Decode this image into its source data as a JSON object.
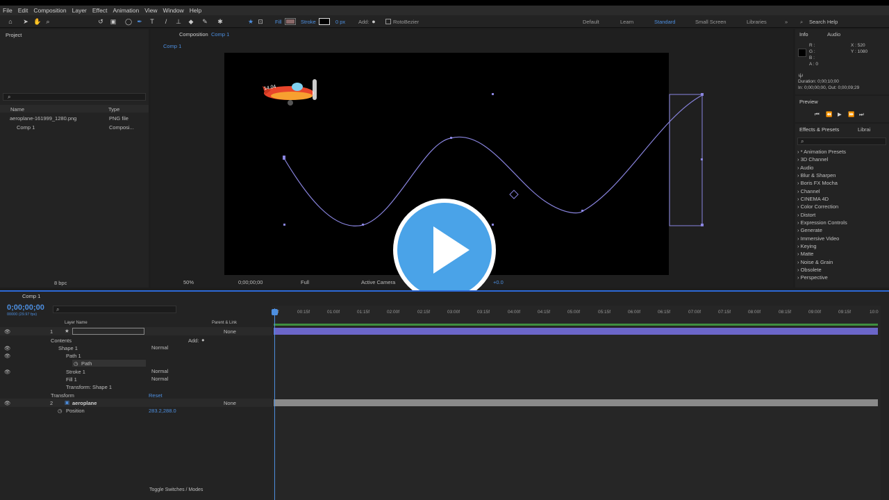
{
  "menu": [
    "File",
    "Edit",
    "Composition",
    "Layer",
    "Effect",
    "Animation",
    "View",
    "Window",
    "Help"
  ],
  "toolbar": {
    "fill_label": "Fill",
    "stroke_label": "Stroke",
    "stroke_px": "0 px",
    "add_label": "Add:",
    "roto_label": "RotoBezier",
    "fill_color": "#8a6a6a"
  },
  "workspaces": [
    "Default",
    "Learn",
    "Standard",
    "Small Screen",
    "Libraries"
  ],
  "search_help": "Search Help",
  "project": {
    "title": "Project",
    "col_name": "Name",
    "col_type": "Type",
    "items": [
      {
        "name": "aeroplane-161999_1280.png",
        "type": "PNG file"
      },
      {
        "name": "Comp 1",
        "type": "Composi..."
      }
    ],
    "bpc": "8 bpc"
  },
  "composition": {
    "tab_prefix": "Composition",
    "tab_name": "Comp 1",
    "sub_tab": "Comp 1",
    "zoom": "50%",
    "timecode": "0;00;00;00",
    "quality": "Full",
    "camera": "Active Camera",
    "exposure": "+0.0",
    "plane_text": "14.04"
  },
  "info": {
    "tab_info": "Info",
    "tab_audio": "Audio",
    "r": "R :",
    "g": "G :",
    "b": "B :",
    "a": "A : 0",
    "x": "X : 520",
    "y": "Y : 1080",
    "layer_icon": "屮",
    "duration": "Duration: 0;00;10;00",
    "inout": "In: 0;00;00;00, Out: 0;00;09;29"
  },
  "preview": {
    "title": "Preview"
  },
  "effects": {
    "title": "Effects & Presets",
    "libraries_tab": "Librai",
    "items": [
      "* Animation Presets",
      "3D Channel",
      "Audio",
      "Blur & Sharpen",
      "Boris FX Mocha",
      "Channel",
      "CINEMA 4D",
      "Color Correction",
      "Distort",
      "Expression Controls",
      "Generate",
      "Immersive Video",
      "Keying",
      "Matte",
      "Noise & Grain",
      "Obsolete",
      "Perspective"
    ]
  },
  "timeline": {
    "tab": "Comp 1",
    "timecode": "0;00;00;00",
    "timecode_sub": "00000 (29.97 fps)",
    "col_layer": "Layer Name",
    "col_parent": "Parent & Link",
    "ticks": [
      "0f",
      "00:15f",
      "01:00f",
      "01:15f",
      "02:00f",
      "02:15f",
      "03:00f",
      "03:15f",
      "04:00f",
      "04:15f",
      "05:00f",
      "05:15f",
      "06:00f",
      "06:15f",
      "07:00f",
      "07:15f",
      "08:00f",
      "08:15f",
      "09:00f",
      "09:15f",
      "10:0"
    ],
    "layers": [
      {
        "num": "1",
        "parent": "None"
      },
      {
        "num": "2",
        "name": "aeroplane",
        "parent": "None"
      }
    ],
    "contents": "Contents",
    "add": "Add:",
    "shape1": "Shape 1",
    "normal": "Normal",
    "path1": "Path 1",
    "path": "Path",
    "stroke1": "Stroke 1",
    "fill1": "Fill 1",
    "transform_shape": "Transform: Shape 1",
    "transform": "Transform",
    "reset": "Reset",
    "position": "Position",
    "position_value": "283.2,288.0",
    "toggle": "Toggle Switches / Modes"
  },
  "colors": {
    "accent": "#4d8fe0",
    "path_stroke": "#8a85e0",
    "layer_bar": "#6b66c9",
    "play": "#4aa3e8"
  }
}
